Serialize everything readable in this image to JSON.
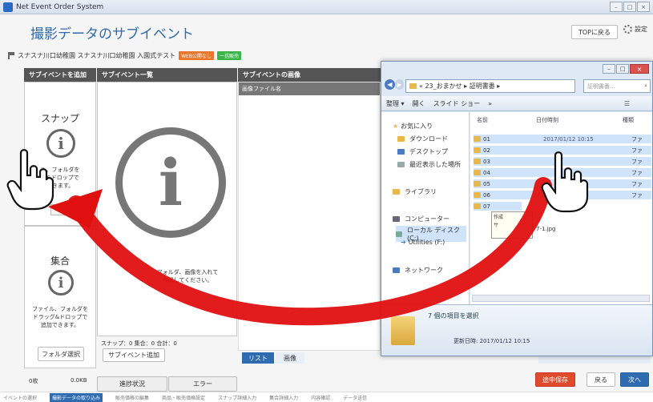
{
  "window": {
    "title": "Net Event Order System"
  },
  "header": {
    "page_title": "撮影データのサブイベント",
    "top_button": "TOPに戻る",
    "settings_label": "設定"
  },
  "info_row": {
    "text": "スナスナ川口幼稚園 スナスナ川口幼稚園  入園式テスト",
    "badge_web": "WEB公開なし",
    "badge_sales": "一括販売",
    "badge_web_color": "#e8762c",
    "badge_sales_color": "#3bb54a"
  },
  "panels": {
    "add_head": "サブイベントを追加",
    "list_head": "サブイベント一覧",
    "images_head": "サブイベントの画像",
    "images_col": "画像ファイル名"
  },
  "add_panel": {
    "snap_title": "スナップ",
    "snap_desc_1": "ル、フォルダを",
    "snap_desc_2": "グ&ドロップで",
    "snap_desc_3": "できます。",
    "group_title": "集合",
    "group_desc_1": "ファイル、フォルダを",
    "group_desc_2": "ドラッグ&ドロップで",
    "group_desc_3": "追加できます。",
    "folder_select": "フォルダ選択",
    "count": "0枚",
    "size": "0.0KB"
  },
  "list_panel": {
    "hint_1": "フォルダ、画像を入れて",
    "hint_2": "作成してください。",
    "summary": "スナップ：0  集合：0  合計：0",
    "add_button": "サブイベント追加"
  },
  "bottom": {
    "progress_tab": "進捗状況",
    "error_tab": "エラー",
    "list_tab": "リスト",
    "image_tab": "画像",
    "save_button": "途中保存",
    "back_button": "戻る",
    "next_button": "次へ",
    "save_color": "#e04b2c",
    "next_color": "#2f6bb0"
  },
  "dialog": {
    "path": "« 23_おまかせ ▸ 証明書番 ▸",
    "search_placeholder": "証明書番...",
    "tool_organize": "整理 ▾",
    "tool_open": "開く",
    "tool_slideshow": "スライド ショー",
    "tool_more": "»",
    "nav": [
      "お気に入り",
      "ダウンロード",
      "デスクトップ",
      "最近表示した場所",
      "ライブラリ",
      "コンピューター",
      "ローカル ディスク (C:)",
      "Utilities (F:)",
      "ネットワーク"
    ],
    "col_name": "名前",
    "col_date": "日付時刻",
    "col_type": "種類",
    "files": [
      {
        "name": "01",
        "date": "2017/01/12 10:15",
        "type": "ファ"
      },
      {
        "name": "02",
        "date": "",
        "type": "ファ"
      },
      {
        "name": "03",
        "date": "",
        "type": "ファ"
      },
      {
        "name": "04",
        "date": "",
        "type": "ファ"
      },
      {
        "name": "05",
        "date": "",
        "type": "ファ"
      },
      {
        "name": "06",
        "date": "",
        "type": "ファ"
      },
      {
        "name": "07",
        "date": "",
        "type": ""
      }
    ],
    "tooltip_1": "作成",
    "tooltip_2": "サ",
    "tooltip_file": "7-1.jpg",
    "selected_count": "7 個の項目を選択",
    "updated": "更新日時: 2017/01/12 10:15"
  },
  "footer": {
    "steps": [
      "イベントの選択",
      "撮影データの取り込み",
      "販売価格の編集",
      "商品・販売価格設定",
      "スナップ詳細入力",
      "集合詳細入力",
      "内容確認",
      "データ送信"
    ]
  },
  "arrow_color": "#e01010"
}
